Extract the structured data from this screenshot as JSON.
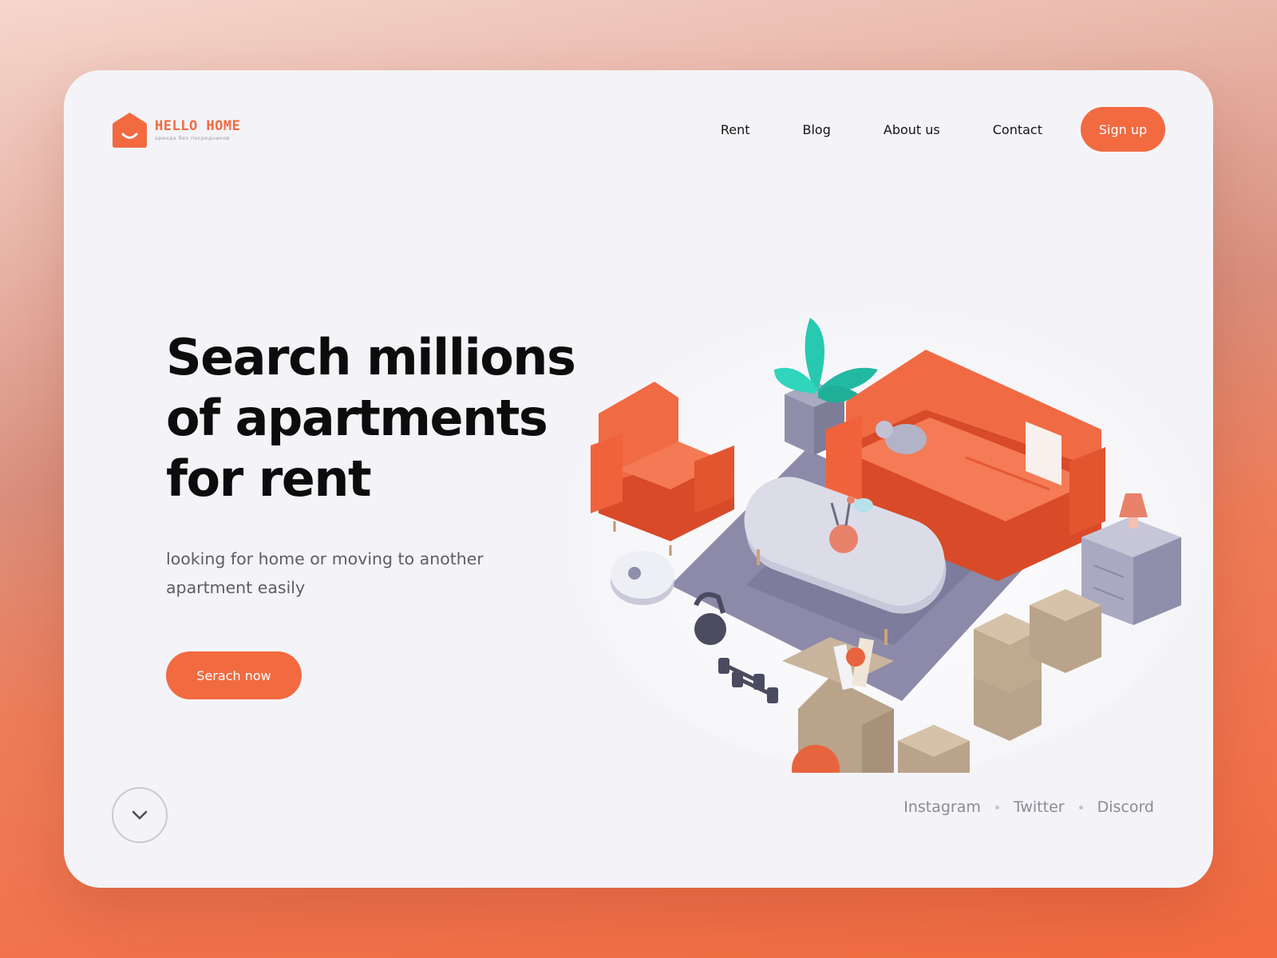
{
  "brand": {
    "name": "HELLO HOME",
    "tagline": "аренда без посредников",
    "logo_icon": "house-smile-icon",
    "accent_color": "#f26a40"
  },
  "nav": {
    "items": [
      {
        "label": "Rent"
      },
      {
        "label": "Blog"
      },
      {
        "label": "About us"
      },
      {
        "label": "Contact"
      }
    ],
    "signup_label": "Sign up"
  },
  "hero": {
    "title_lines": [
      "Search millions",
      "of apartments",
      "for rent"
    ],
    "subtitle_lines": [
      "looking for home or moving to another",
      "apartment easily"
    ],
    "cta_label": "Serach now",
    "illustration_icon": "isometric-living-room-illustration"
  },
  "footer": {
    "scroll_icon": "chevron-down-icon",
    "social": [
      {
        "label": "Instagram"
      },
      {
        "label": "Twitter"
      },
      {
        "label": "Discord"
      }
    ]
  }
}
